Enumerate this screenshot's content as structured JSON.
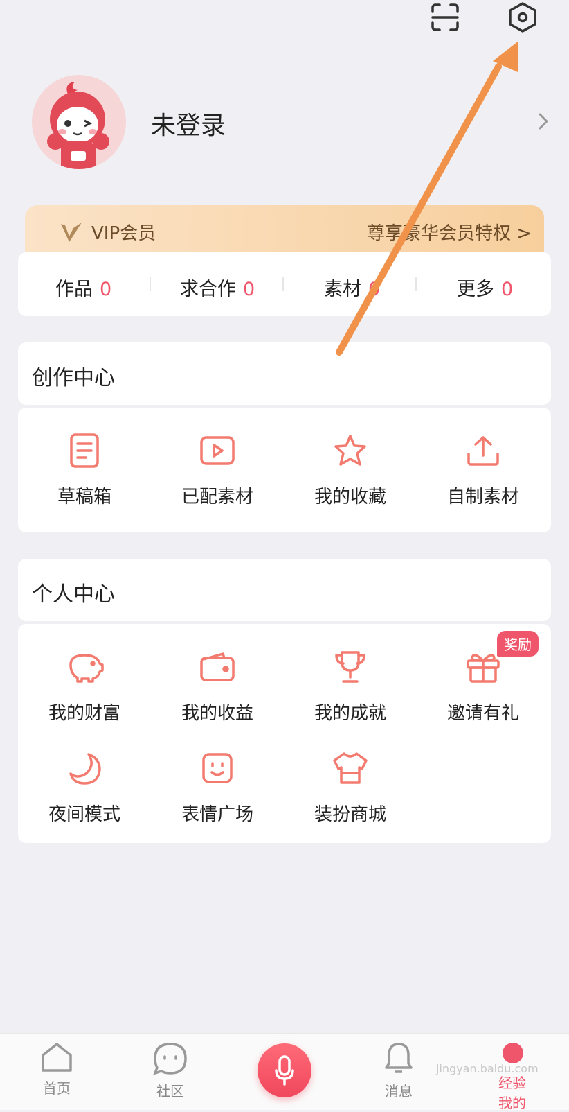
{
  "header": {
    "scan_icon": "scan-icon",
    "settings_icon": "settings-hexagon-icon"
  },
  "profile": {
    "name": "未登录"
  },
  "vip": {
    "label": "VIP会员",
    "privilege": "尊享豪华会员特权 >"
  },
  "stats": [
    {
      "label": "作品",
      "value": "0"
    },
    {
      "label": "求合作",
      "value": "0"
    },
    {
      "label": "素材",
      "value": "0"
    },
    {
      "label": "更多",
      "value": "0"
    }
  ],
  "creation": {
    "title": "创作中心",
    "items": [
      {
        "label": "草稿箱",
        "icon": "draft-icon"
      },
      {
        "label": "已配素材",
        "icon": "video-play-icon"
      },
      {
        "label": "我的收藏",
        "icon": "star-icon"
      },
      {
        "label": "自制素材",
        "icon": "upload-icon"
      }
    ]
  },
  "personal": {
    "title": "个人中心",
    "badge": "奖励",
    "items": [
      {
        "label": "我的财富",
        "icon": "piggy-bank-icon"
      },
      {
        "label": "我的收益",
        "icon": "wallet-icon"
      },
      {
        "label": "我的成就",
        "icon": "trophy-icon"
      },
      {
        "label": "邀请有礼",
        "icon": "gift-icon"
      },
      {
        "label": "夜间模式",
        "icon": "moon-icon"
      },
      {
        "label": "表情广场",
        "icon": "smile-face-icon"
      },
      {
        "label": "装扮商城",
        "icon": "shirt-icon"
      }
    ]
  },
  "nav": {
    "home": "首页",
    "community": "社区",
    "messages": "消息",
    "me": "我的",
    "me_overlay": "经验"
  },
  "watermark": "jingyan.baidu.com",
  "colors": {
    "accent": "#f0566b",
    "annotation_arrow": "#f0924a"
  }
}
